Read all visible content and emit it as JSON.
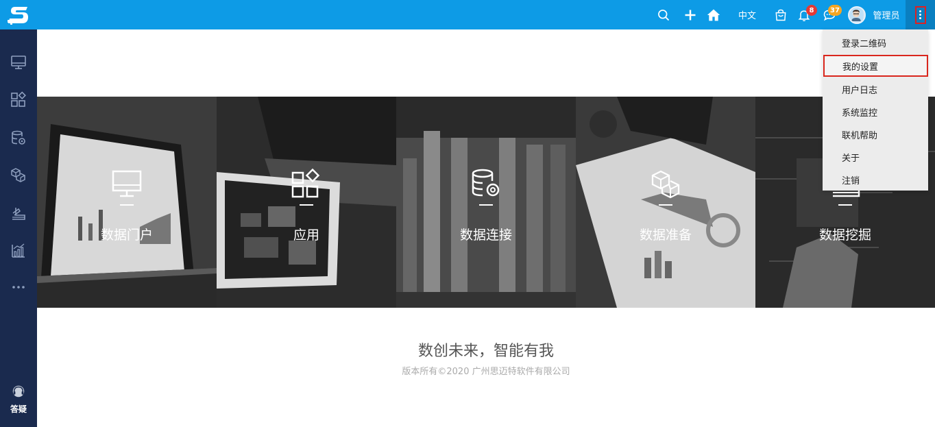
{
  "topbar": {
    "language_label": "中文",
    "notification_count": "8",
    "message_count": "37",
    "user_name": "管理员"
  },
  "sidebar": {
    "help_label": "答疑"
  },
  "tiles": [
    {
      "label": "数据门户",
      "icon": "monitor-icon"
    },
    {
      "label": "应用",
      "icon": "apps-icon"
    },
    {
      "label": "数据连接",
      "icon": "database-gear-icon"
    },
    {
      "label": "数据准备",
      "icon": "cubes-icon"
    },
    {
      "label": "数据挖掘",
      "icon": "mining-icon"
    }
  ],
  "footer": {
    "slogan": "数创未来，智能有我",
    "copyright": "版本所有©2020 广州思迈特软件有限公司"
  },
  "dropdown": {
    "items": [
      "登录二维码",
      "我的设置",
      "用户日志",
      "系统监控",
      "联机帮助",
      "关于",
      "注销"
    ],
    "selected": "我的设置"
  },
  "colors": {
    "topbar": "#0d9be6",
    "sidebar": "#1a2a4e",
    "highlight": "#d9261c"
  }
}
